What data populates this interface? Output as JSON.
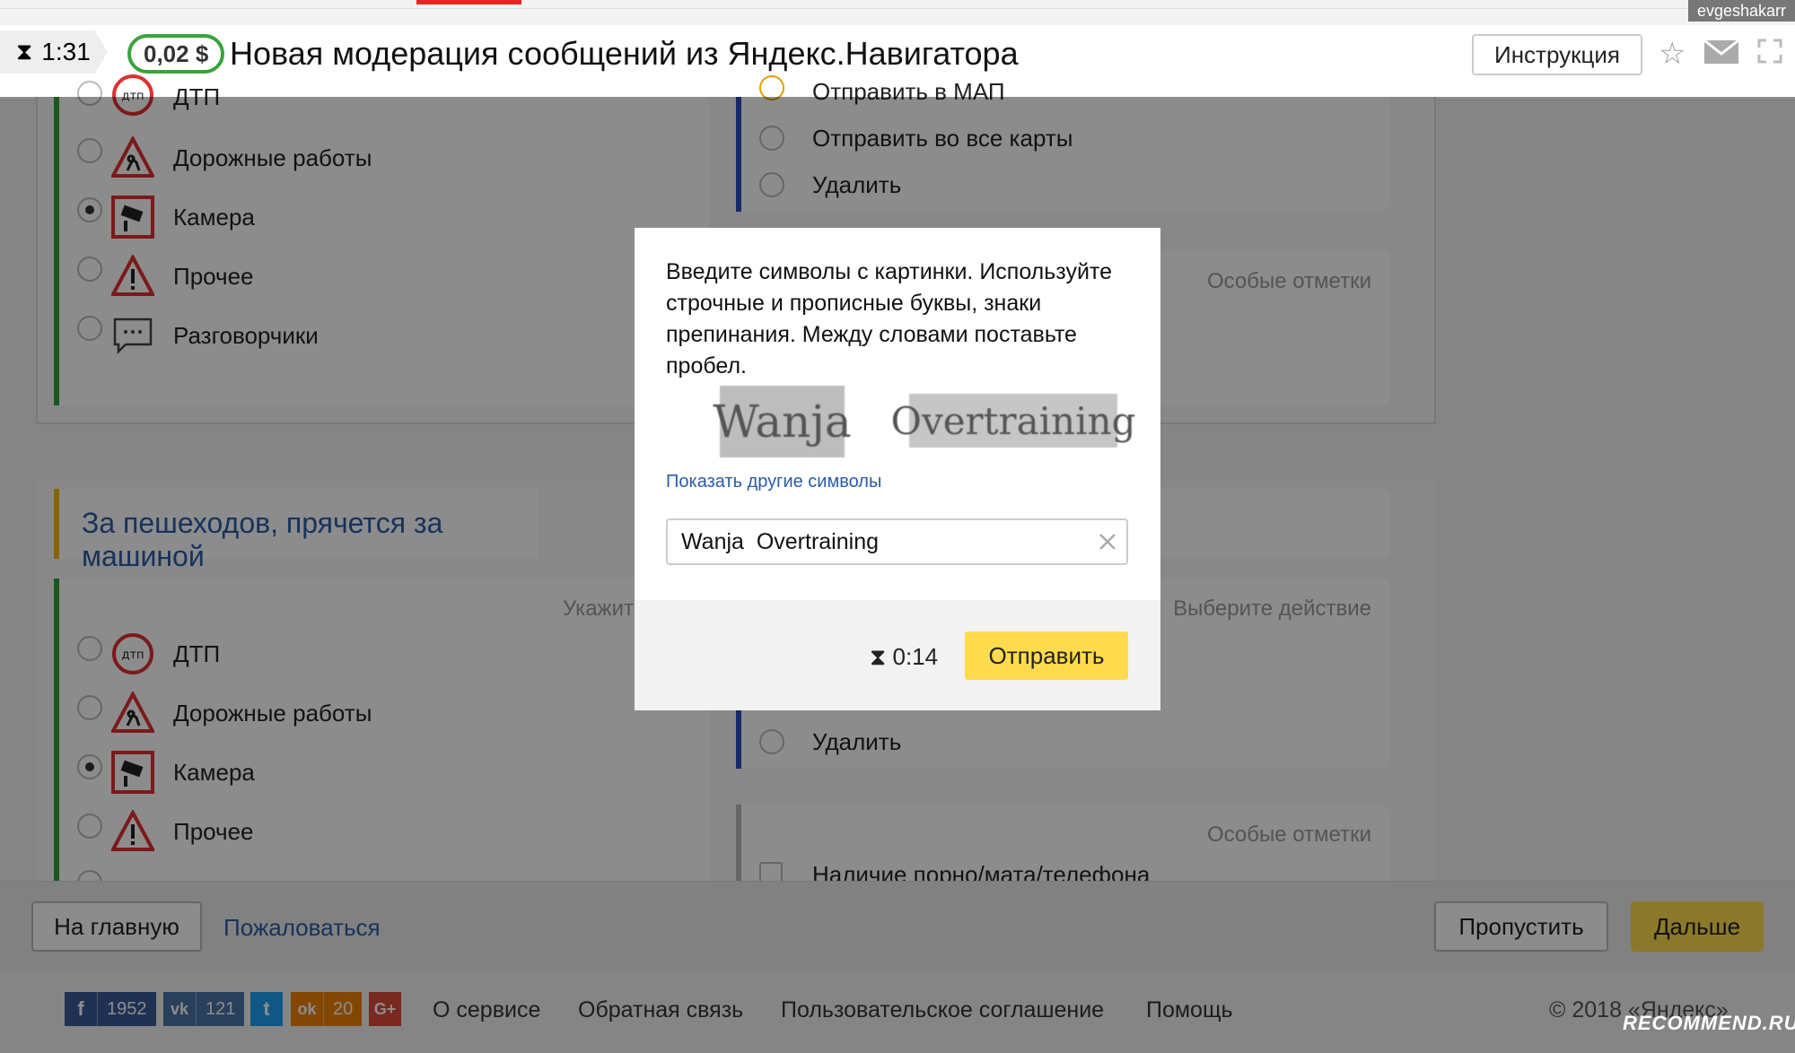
{
  "header": {
    "username": "evgeshakarr",
    "timer": "1:31",
    "price": "0,02 $",
    "title": "Новая модерация сообщений из Яндекс.Навигатора",
    "instructions_label": "Инструкция"
  },
  "task1": {
    "categories": [
      {
        "label": "ДТП",
        "checked": false
      },
      {
        "label": "Дорожные работы",
        "checked": false
      },
      {
        "label": "Камера",
        "checked": true
      },
      {
        "label": "Прочее",
        "checked": false
      },
      {
        "label": "Разговорчики",
        "checked": false
      }
    ],
    "actions": [
      {
        "label": "Отправить в МАП"
      },
      {
        "label": "Отправить во все карты"
      },
      {
        "label": "Удалить"
      }
    ],
    "special_marks_label": "Особые отметки"
  },
  "task2": {
    "title": "За пешеходов, прячется за машиной",
    "categories_hint": "Укажит",
    "action_hint": "Выберите действие",
    "categories": [
      {
        "label": "ДТП",
        "checked": false
      },
      {
        "label": "Дорожные работы",
        "checked": false
      },
      {
        "label": "Камера",
        "checked": true
      },
      {
        "label": "Прочее",
        "checked": false
      }
    ],
    "actions": [
      {
        "label": "Удалить"
      }
    ],
    "special_marks_label": "Особые отметки",
    "special_marks": [
      {
        "label": "Наличие порно/мата/телефона"
      }
    ]
  },
  "bottom": {
    "home_label": "На главную",
    "complain_label": "Пожаловаться",
    "skip_label": "Пропустить",
    "next_label": "Дальше"
  },
  "footer": {
    "social": [
      {
        "icon": "facebook-icon",
        "glyph": "f",
        "count": "1952",
        "color": "#3b5998"
      },
      {
        "icon": "vk-icon",
        "glyph": "vk",
        "count": "121",
        "color": "#4a76a8"
      },
      {
        "icon": "twitter-icon",
        "glyph": "t",
        "count": "",
        "color": "#1da1f2"
      },
      {
        "icon": "odnoklassniki-icon",
        "glyph": "ok",
        "count": "20",
        "color": "#ee8208"
      },
      {
        "icon": "google-plus-icon",
        "glyph": "G+",
        "count": "",
        "color": "#dd4b39"
      }
    ],
    "links": [
      "О сервисе",
      "Обратная связь",
      "Пользовательское соглашение",
      "Помощь"
    ],
    "copyright": "© 2018 «Яндекс»",
    "watermark": "RECOMMEND.RU"
  },
  "modal": {
    "instructions": "Введите символы с картинки. Используйте строчные и прописные буквы, знаки препинания. Между словами поставьте пробел.",
    "captcha_words": [
      "Wanja",
      "Overtraining"
    ],
    "show_other_label": "Показать другие символы",
    "input_value": "Wanja  Overtraining",
    "timer": "0:14",
    "submit_label": "Отправить"
  },
  "colors": {
    "accent_yellow": "#ffdb4d",
    "link_blue": "#2a5ca8",
    "price_green": "#3aa33a",
    "progress_red": "#e52620"
  }
}
